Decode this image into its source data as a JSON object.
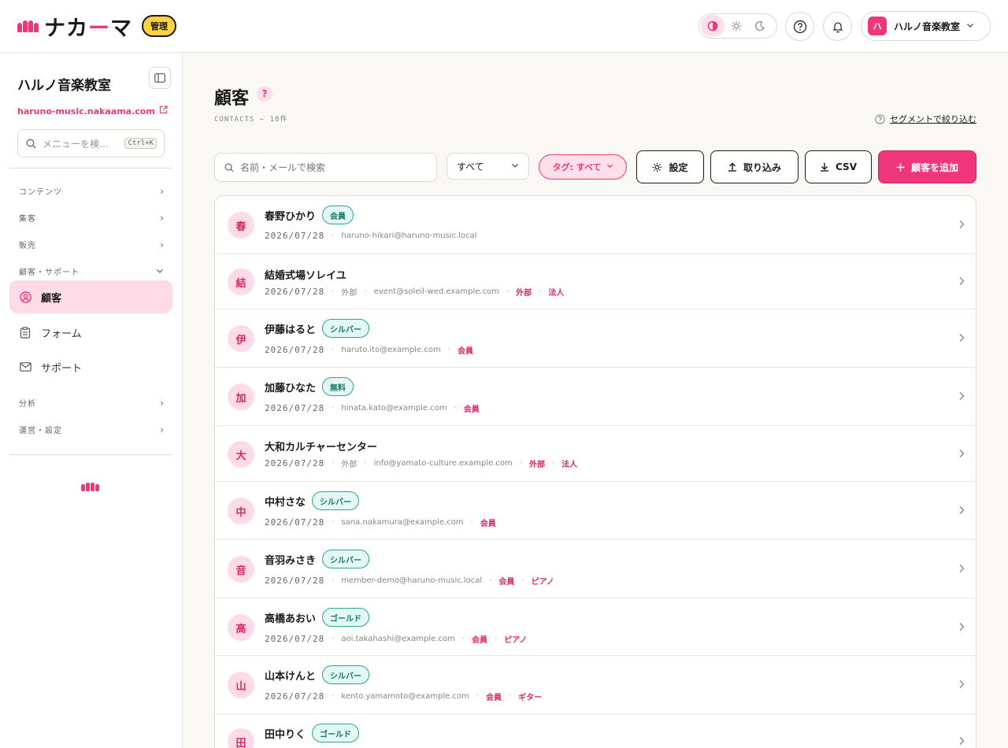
{
  "header": {
    "logo_text_a": "ナカ",
    "logo_text_dash": "ー",
    "logo_text_b": "マ",
    "admin_badge": "管理",
    "account_icon_text": "ハ",
    "account_name": "ハルノ音楽教室"
  },
  "sidebar": {
    "school_name": "ハルノ音楽教室",
    "site_link": "haruno-music.nakaama.com",
    "search_placeholder": "メニューを検…",
    "search_shortcut": "Ctrl+K",
    "groups": {
      "contents": "コンテンツ",
      "marketing": "集客",
      "sales": "販売",
      "customers": "顧客・サポート",
      "analytics": "分析",
      "operations": "運営・設定"
    },
    "items": {
      "customers": "顧客",
      "forms": "フォーム",
      "support": "サポート"
    }
  },
  "main": {
    "title": "顧客",
    "help": "?",
    "subtitle": "CONTACTS — 18件",
    "segment_link": "セグメントで絞り込む",
    "search_placeholder": "名前・メールで検索",
    "filter_select": "すべて",
    "tag_filter": "タグ: すべて",
    "settings_button": "設定",
    "import_button": "取り込み",
    "csv_button": "CSV",
    "add_button": "顧客を追加"
  },
  "contacts": [
    {
      "initial": "春",
      "name": "春野ひかり",
      "badge": "会員",
      "date": "2026/07/28",
      "type": "",
      "email": "haruno-hikari@haruno-music.local",
      "tags": []
    },
    {
      "initial": "結",
      "name": "結婚式場ソレイユ",
      "badge": "",
      "date": "2026/07/28",
      "type": "外部",
      "email": "event@soleil-wed.example.com",
      "tags": [
        "外部",
        "法人"
      ]
    },
    {
      "initial": "伊",
      "name": "伊藤はると",
      "badge": "シルバー",
      "date": "2026/07/28",
      "type": "",
      "email": "haruto.ito@example.com",
      "tags": [
        "会員"
      ]
    },
    {
      "initial": "加",
      "name": "加藤ひなた",
      "badge": "無料",
      "date": "2026/07/28",
      "type": "",
      "email": "hinata.kato@example.com",
      "tags": [
        "会員"
      ]
    },
    {
      "initial": "大",
      "name": "大和カルチャーセンター",
      "badge": "",
      "date": "2026/07/28",
      "type": "外部",
      "email": "info@yamato-culture.example.com",
      "tags": [
        "外部",
        "法人"
      ]
    },
    {
      "initial": "中",
      "name": "中村さな",
      "badge": "シルバー",
      "date": "2026/07/28",
      "type": "",
      "email": "sana.nakamura@example.com",
      "tags": [
        "会員"
      ]
    },
    {
      "initial": "音",
      "name": "音羽みさき",
      "badge": "シルバー",
      "date": "2026/07/28",
      "type": "",
      "email": "member-demo@haruno-music.local",
      "tags": [
        "会員",
        "ピアノ"
      ]
    },
    {
      "initial": "高",
      "name": "高橋あおい",
      "badge": "ゴールド",
      "date": "2026/07/28",
      "type": "",
      "email": "aoi.takahashi@example.com",
      "tags": [
        "会員",
        "ピアノ"
      ]
    },
    {
      "initial": "山",
      "name": "山本けんと",
      "badge": "シルバー",
      "date": "2026/07/28",
      "type": "",
      "email": "kento.yamamoto@example.com",
      "tags": [
        "会員",
        "ギター"
      ]
    },
    {
      "initial": "田",
      "name": "田中りく",
      "badge": "ゴールド",
      "date": "",
      "type": "",
      "email": "",
      "tags": []
    }
  ],
  "colors": {
    "accent": "#f0367b",
    "accent_light": "#ffdbe7",
    "badge_teal": "#2aa598",
    "admin_yellow": "#ffd23f"
  }
}
